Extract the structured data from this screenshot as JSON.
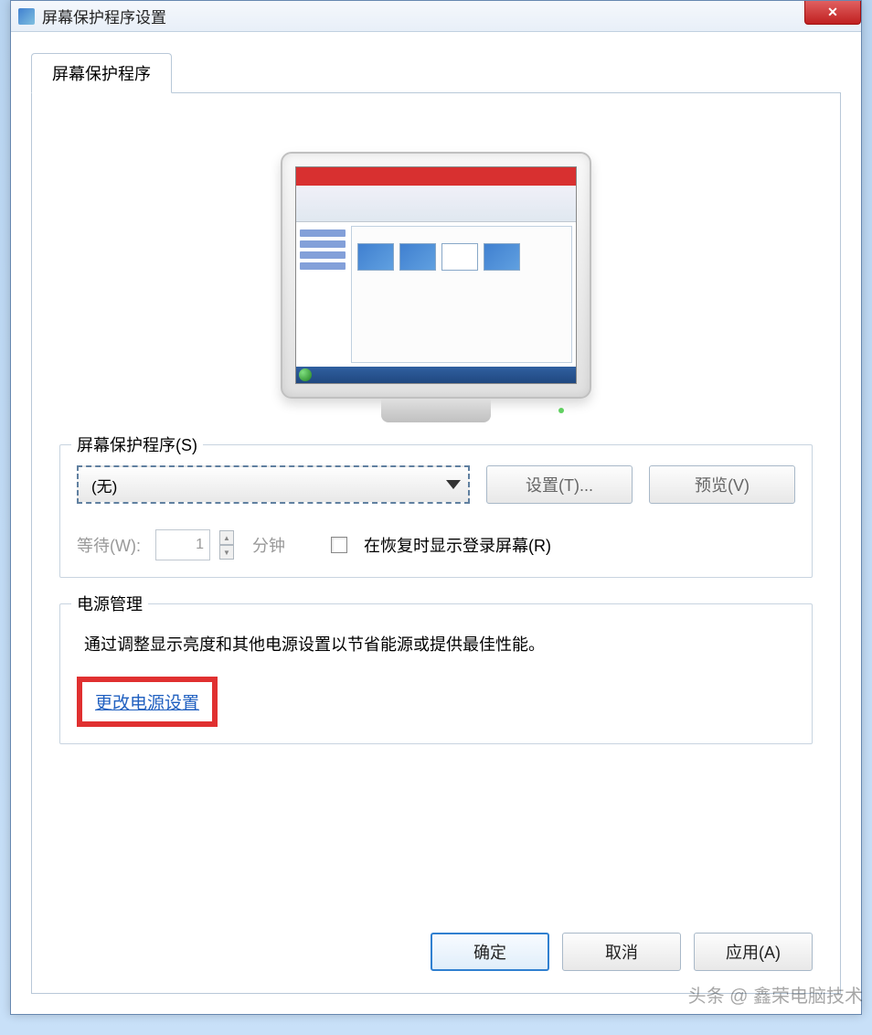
{
  "window": {
    "title": "屏幕保护程序设置",
    "close_glyph": "✕"
  },
  "tab": {
    "label": "屏幕保护程序"
  },
  "screensaver": {
    "group_label": "屏幕保护程序(S)",
    "selected": "(无)",
    "settings_btn": "设置(T)...",
    "preview_btn": "预览(V)",
    "wait_label": "等待(W):",
    "wait_value": "1",
    "minutes_label": "分钟",
    "resume_checkbox": "在恢复时显示登录屏幕(R)"
  },
  "power": {
    "group_label": "电源管理",
    "description": "通过调整显示亮度和其他电源设置以节省能源或提供最佳性能。",
    "link": "更改电源设置"
  },
  "footer": {
    "ok": "确定",
    "cancel": "取消",
    "apply": "应用(A)"
  },
  "watermark": "头条 @ 鑫荣电脑技术"
}
